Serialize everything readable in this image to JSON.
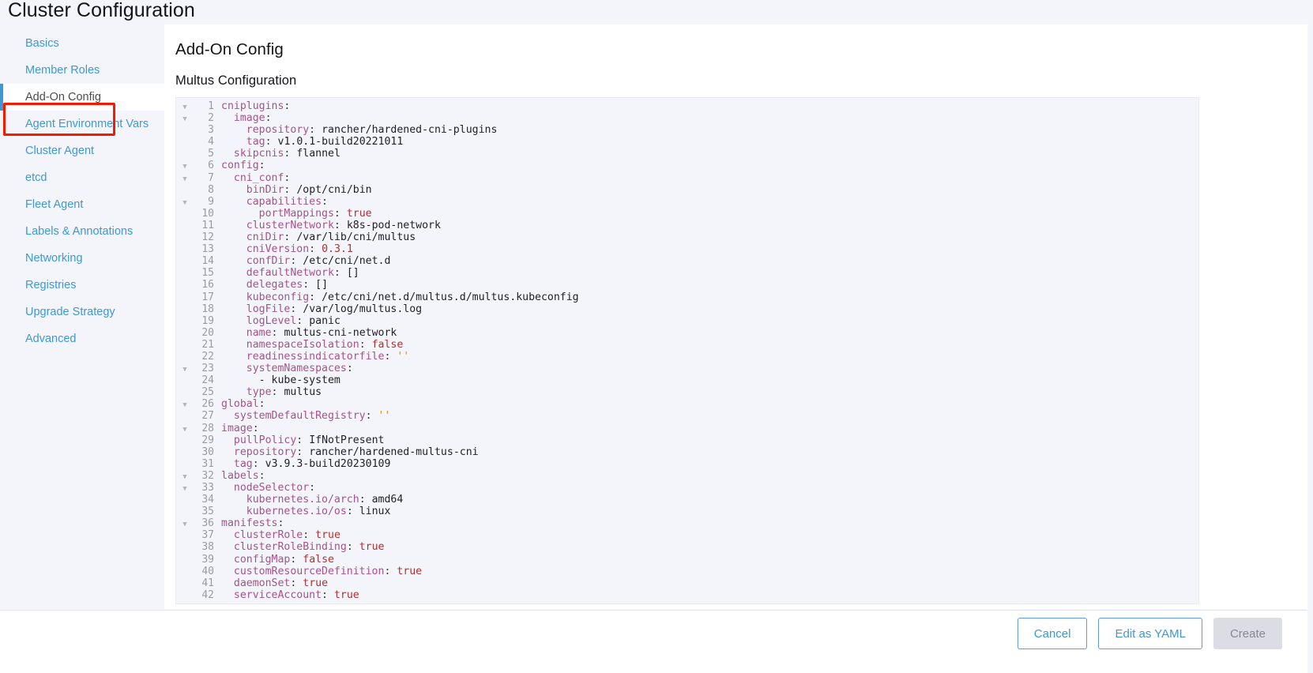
{
  "page": {
    "title": "Cluster Configuration"
  },
  "sidebar": {
    "items": [
      {
        "label": "Basics",
        "active": false
      },
      {
        "label": "Member Roles",
        "active": false
      },
      {
        "label": "Add-On Config",
        "active": true
      },
      {
        "label": "Agent Environment Vars",
        "active": false
      },
      {
        "label": "Cluster Agent",
        "active": false
      },
      {
        "label": "etcd",
        "active": false
      },
      {
        "label": "Fleet Agent",
        "active": false
      },
      {
        "label": "Labels & Annotations",
        "active": false
      },
      {
        "label": "Networking",
        "active": false
      },
      {
        "label": "Registries",
        "active": false
      },
      {
        "label": "Upgrade Strategy",
        "active": false
      },
      {
        "label": "Advanced",
        "active": false
      }
    ],
    "accent_color": "#3d98d3",
    "annotation_color": "#f51b00"
  },
  "content": {
    "heading": "Add-On Config",
    "subheading": "Multus Configuration"
  },
  "editor": {
    "language": "yaml",
    "lines": [
      {
        "n": 1,
        "fold": true,
        "indent": 0,
        "key": "cniplugins",
        "value": ""
      },
      {
        "n": 2,
        "fold": true,
        "indent": 1,
        "key": "image",
        "value": ""
      },
      {
        "n": 3,
        "fold": false,
        "indent": 2,
        "key": "repository",
        "value": "rancher/hardened-cni-plugins",
        "type": "plain"
      },
      {
        "n": 4,
        "fold": false,
        "indent": 2,
        "key": "tag",
        "value": "v1.0.1-build20221011",
        "type": "plain"
      },
      {
        "n": 5,
        "fold": false,
        "indent": 1,
        "key": "skipcnis",
        "value": "flannel",
        "type": "plain"
      },
      {
        "n": 6,
        "fold": true,
        "indent": 0,
        "key": "config",
        "value": ""
      },
      {
        "n": 7,
        "fold": true,
        "indent": 1,
        "key": "cni_conf",
        "value": ""
      },
      {
        "n": 8,
        "fold": false,
        "indent": 2,
        "key": "binDir",
        "value": "/opt/cni/bin",
        "type": "plain"
      },
      {
        "n": 9,
        "fold": true,
        "indent": 2,
        "key": "capabilities",
        "value": ""
      },
      {
        "n": 10,
        "fold": false,
        "indent": 3,
        "key": "portMappings",
        "value": "true",
        "type": "bool"
      },
      {
        "n": 11,
        "fold": false,
        "indent": 2,
        "key": "clusterNetwork",
        "value": "k8s-pod-network",
        "type": "plain"
      },
      {
        "n": 12,
        "fold": false,
        "indent": 2,
        "key": "cniDir",
        "value": "/var/lib/cni/multus",
        "type": "plain"
      },
      {
        "n": 13,
        "fold": false,
        "indent": 2,
        "key": "cniVersion",
        "value": "0.3.1",
        "type": "num"
      },
      {
        "n": 14,
        "fold": false,
        "indent": 2,
        "key": "confDir",
        "value": "/etc/cni/net.d",
        "type": "plain"
      },
      {
        "n": 15,
        "fold": false,
        "indent": 2,
        "key": "defaultNetwork",
        "value": "[]",
        "type": "plain"
      },
      {
        "n": 16,
        "fold": false,
        "indent": 2,
        "key": "delegates",
        "value": "[]",
        "type": "plain"
      },
      {
        "n": 17,
        "fold": false,
        "indent": 2,
        "key": "kubeconfig",
        "value": "/etc/cni/net.d/multus.d/multus.kubeconfig",
        "type": "plain"
      },
      {
        "n": 18,
        "fold": false,
        "indent": 2,
        "key": "logFile",
        "value": "/var/log/multus.log",
        "type": "plain"
      },
      {
        "n": 19,
        "fold": false,
        "indent": 2,
        "key": "logLevel",
        "value": "panic",
        "type": "plain"
      },
      {
        "n": 20,
        "fold": false,
        "indent": 2,
        "key": "name",
        "value": "multus-cni-network",
        "type": "plain"
      },
      {
        "n": 21,
        "fold": false,
        "indent": 2,
        "key": "namespaceIsolation",
        "value": "false",
        "type": "bool"
      },
      {
        "n": 22,
        "fold": false,
        "indent": 2,
        "key": "readinessindicatorfile",
        "value": "''",
        "type": "str"
      },
      {
        "n": 23,
        "fold": true,
        "indent": 2,
        "key": "systemNamespaces",
        "value": ""
      },
      {
        "n": 24,
        "fold": false,
        "indent": 3,
        "key": "",
        "value": "- kube-system",
        "type": "listitem"
      },
      {
        "n": 25,
        "fold": false,
        "indent": 2,
        "key": "type",
        "value": "multus",
        "type": "plain"
      },
      {
        "n": 26,
        "fold": true,
        "indent": 0,
        "key": "global",
        "value": ""
      },
      {
        "n": 27,
        "fold": false,
        "indent": 1,
        "key": "systemDefaultRegistry",
        "value": "''",
        "type": "str"
      },
      {
        "n": 28,
        "fold": true,
        "indent": 0,
        "key": "image",
        "value": ""
      },
      {
        "n": 29,
        "fold": false,
        "indent": 1,
        "key": "pullPolicy",
        "value": "IfNotPresent",
        "type": "plain"
      },
      {
        "n": 30,
        "fold": false,
        "indent": 1,
        "key": "repository",
        "value": "rancher/hardened-multus-cni",
        "type": "plain"
      },
      {
        "n": 31,
        "fold": false,
        "indent": 1,
        "key": "tag",
        "value": "v3.9.3-build20230109",
        "type": "plain"
      },
      {
        "n": 32,
        "fold": true,
        "indent": 0,
        "key": "labels",
        "value": ""
      },
      {
        "n": 33,
        "fold": true,
        "indent": 1,
        "key": "nodeSelector",
        "value": ""
      },
      {
        "n": 34,
        "fold": false,
        "indent": 2,
        "key": "kubernetes.io/arch",
        "value": "amd64",
        "type": "plain"
      },
      {
        "n": 35,
        "fold": false,
        "indent": 2,
        "key": "kubernetes.io/os",
        "value": "linux",
        "type": "plain"
      },
      {
        "n": 36,
        "fold": true,
        "indent": 0,
        "key": "manifests",
        "value": ""
      },
      {
        "n": 37,
        "fold": false,
        "indent": 1,
        "key": "clusterRole",
        "value": "true",
        "type": "bool"
      },
      {
        "n": 38,
        "fold": false,
        "indent": 1,
        "key": "clusterRoleBinding",
        "value": "true",
        "type": "bool"
      },
      {
        "n": 39,
        "fold": false,
        "indent": 1,
        "key": "configMap",
        "value": "false",
        "type": "bool"
      },
      {
        "n": 40,
        "fold": false,
        "indent": 1,
        "key": "customResourceDefinition",
        "value": "true",
        "type": "bool"
      },
      {
        "n": 41,
        "fold": false,
        "indent": 1,
        "key": "daemonSet",
        "value": "true",
        "type": "bool"
      },
      {
        "n": 42,
        "fold": false,
        "indent": 1,
        "key": "serviceAccount",
        "value": "true",
        "type": "bool"
      }
    ]
  },
  "footer": {
    "cancel_label": "Cancel",
    "edit_yaml_label": "Edit as YAML",
    "create_label": "Create"
  }
}
